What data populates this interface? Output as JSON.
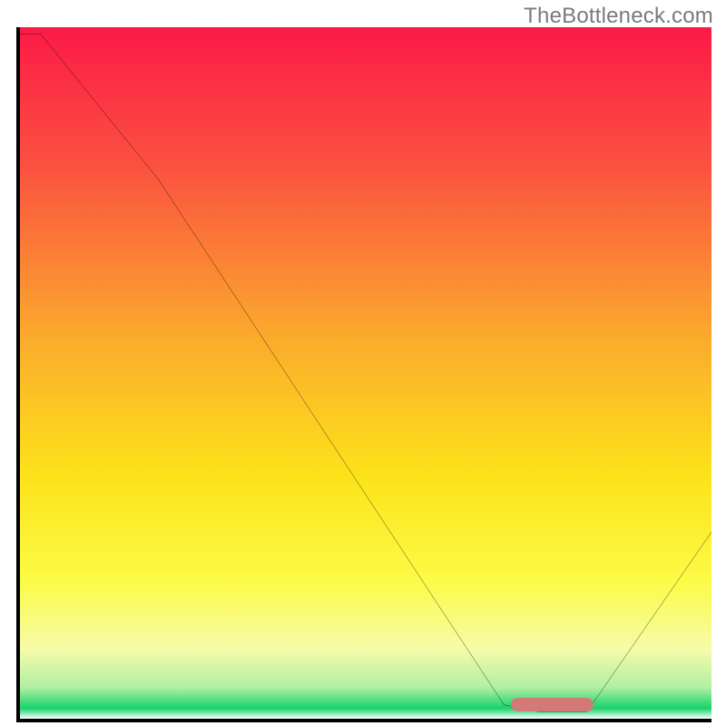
{
  "watermark": "TheBottleneck.com",
  "chart_data": {
    "type": "line",
    "title": "",
    "xlabel": "",
    "ylabel": "",
    "xlim": [
      0,
      100
    ],
    "ylim": [
      0,
      100
    ],
    "x": [
      0,
      3,
      20,
      70,
      75,
      82,
      100
    ],
    "values": [
      99,
      99,
      78,
      2,
      1,
      1,
      27
    ],
    "optimal_range_x": [
      71,
      83
    ],
    "optimal_y": 2,
    "background_gradient": {
      "stops": [
        {
          "pos": 0.0,
          "color": "#fb1a47"
        },
        {
          "pos": 0.2,
          "color": "#fb5140"
        },
        {
          "pos": 0.45,
          "color": "#fbab2c"
        },
        {
          "pos": 0.65,
          "color": "#fce31a"
        },
        {
          "pos": 0.8,
          "color": "#fcfb46"
        },
        {
          "pos": 0.9,
          "color": "#f6fba9"
        },
        {
          "pos": 0.955,
          "color": "#b0efa3"
        },
        {
          "pos": 0.985,
          "color": "#17d36b"
        },
        {
          "pos": 1.0,
          "color": "#ffffff"
        }
      ]
    }
  }
}
